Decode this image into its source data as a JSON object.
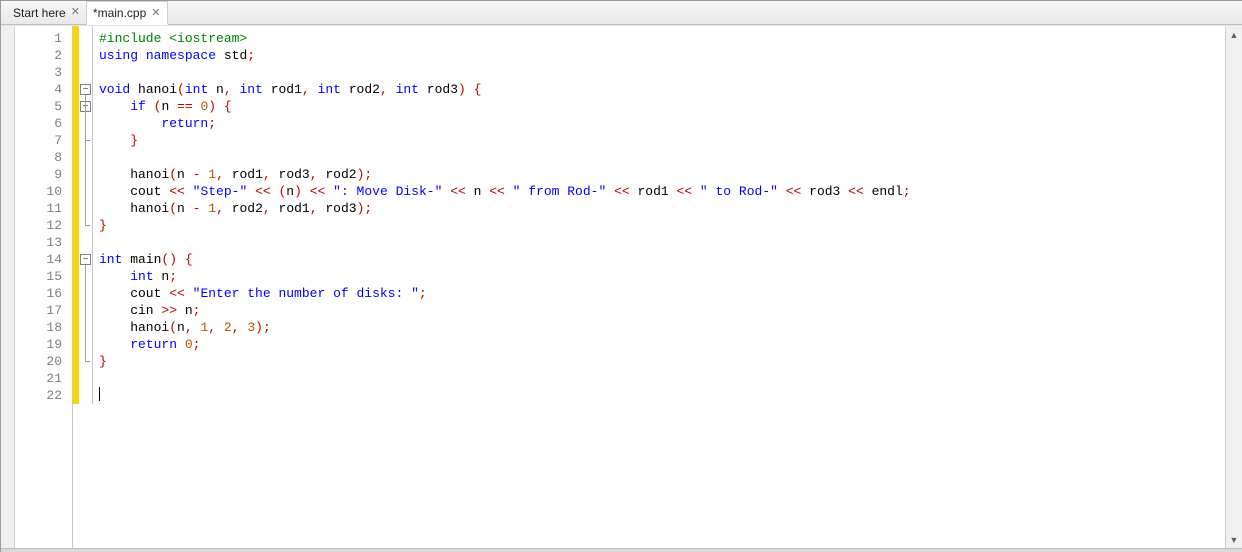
{
  "tabs": [
    {
      "label": "Start here",
      "active": false
    },
    {
      "label": "*main.cpp",
      "active": true
    }
  ],
  "line_count": 22,
  "fold_minus_lines": [
    4,
    5,
    14
  ],
  "code_lines": [
    [
      [
        "pp",
        "#include "
      ],
      [
        "inc",
        "<iostream>"
      ]
    ],
    [
      [
        "kw",
        "using"
      ],
      [
        "nm",
        " "
      ],
      [
        "kw",
        "namespace"
      ],
      [
        "nm",
        " std"
      ],
      [
        "op",
        ";"
      ]
    ],
    [],
    [
      [
        "kw",
        "void"
      ],
      [
        "nm",
        " hanoi"
      ],
      [
        "op",
        "("
      ],
      [
        "kw",
        "int"
      ],
      [
        "nm",
        " n"
      ],
      [
        "op",
        ","
      ],
      [
        "nm",
        " "
      ],
      [
        "kw",
        "int"
      ],
      [
        "nm",
        " rod1"
      ],
      [
        "op",
        ","
      ],
      [
        "nm",
        " "
      ],
      [
        "kw",
        "int"
      ],
      [
        "nm",
        " rod2"
      ],
      [
        "op",
        ","
      ],
      [
        "nm",
        " "
      ],
      [
        "kw",
        "int"
      ],
      [
        "nm",
        " rod3"
      ],
      [
        "op",
        ")"
      ],
      [
        "nm",
        " "
      ],
      [
        "brace",
        "{"
      ]
    ],
    [
      [
        "nm",
        "    "
      ],
      [
        "kw",
        "if"
      ],
      [
        "nm",
        " "
      ],
      [
        "op",
        "("
      ],
      [
        "nm",
        "n "
      ],
      [
        "op",
        "=="
      ],
      [
        "nm",
        " "
      ],
      [
        "num",
        "0"
      ],
      [
        "op",
        ")"
      ],
      [
        "nm",
        " "
      ],
      [
        "brace",
        "{"
      ]
    ],
    [
      [
        "nm",
        "        "
      ],
      [
        "kw",
        "return"
      ],
      [
        "op",
        ";"
      ]
    ],
    [
      [
        "nm",
        "    "
      ],
      [
        "brace",
        "}"
      ]
    ],
    [],
    [
      [
        "nm",
        "    hanoi"
      ],
      [
        "op",
        "("
      ],
      [
        "nm",
        "n "
      ],
      [
        "op",
        "-"
      ],
      [
        "nm",
        " "
      ],
      [
        "num",
        "1"
      ],
      [
        "op",
        ","
      ],
      [
        "nm",
        " rod1"
      ],
      [
        "op",
        ","
      ],
      [
        "nm",
        " rod3"
      ],
      [
        "op",
        ","
      ],
      [
        "nm",
        " rod2"
      ],
      [
        "op",
        ");"
      ]
    ],
    [
      [
        "nm",
        "    cout "
      ],
      [
        "op",
        "<<"
      ],
      [
        "nm",
        " "
      ],
      [
        "str",
        "\"Step-\""
      ],
      [
        "nm",
        " "
      ],
      [
        "op",
        "<<"
      ],
      [
        "nm",
        " "
      ],
      [
        "op",
        "("
      ],
      [
        "nm",
        "n"
      ],
      [
        "op",
        ")"
      ],
      [
        "nm",
        " "
      ],
      [
        "op",
        "<<"
      ],
      [
        "nm",
        " "
      ],
      [
        "str",
        "\": Move Disk-\""
      ],
      [
        "nm",
        " "
      ],
      [
        "op",
        "<<"
      ],
      [
        "nm",
        " n "
      ],
      [
        "op",
        "<<"
      ],
      [
        "nm",
        " "
      ],
      [
        "str",
        "\" from Rod-\""
      ],
      [
        "nm",
        " "
      ],
      [
        "op",
        "<<"
      ],
      [
        "nm",
        " rod1 "
      ],
      [
        "op",
        "<<"
      ],
      [
        "nm",
        " "
      ],
      [
        "str",
        "\" to Rod-\""
      ],
      [
        "nm",
        " "
      ],
      [
        "op",
        "<<"
      ],
      [
        "nm",
        " rod3 "
      ],
      [
        "op",
        "<<"
      ],
      [
        "nm",
        " endl"
      ],
      [
        "op",
        ";"
      ]
    ],
    [
      [
        "nm",
        "    hanoi"
      ],
      [
        "op",
        "("
      ],
      [
        "nm",
        "n "
      ],
      [
        "op",
        "-"
      ],
      [
        "nm",
        " "
      ],
      [
        "num",
        "1"
      ],
      [
        "op",
        ","
      ],
      [
        "nm",
        " rod2"
      ],
      [
        "op",
        ","
      ],
      [
        "nm",
        " rod1"
      ],
      [
        "op",
        ","
      ],
      [
        "nm",
        " rod3"
      ],
      [
        "op",
        ");"
      ]
    ],
    [
      [
        "brace",
        "}"
      ]
    ],
    [],
    [
      [
        "kw",
        "int"
      ],
      [
        "nm",
        " main"
      ],
      [
        "op",
        "()"
      ],
      [
        "nm",
        " "
      ],
      [
        "brace",
        "{"
      ]
    ],
    [
      [
        "nm",
        "    "
      ],
      [
        "kw",
        "int"
      ],
      [
        "nm",
        " n"
      ],
      [
        "op",
        ";"
      ]
    ],
    [
      [
        "nm",
        "    cout "
      ],
      [
        "op",
        "<<"
      ],
      [
        "nm",
        " "
      ],
      [
        "str",
        "\"Enter the number of disks: \""
      ],
      [
        "op",
        ";"
      ]
    ],
    [
      [
        "nm",
        "    cin "
      ],
      [
        "op",
        ">>"
      ],
      [
        "nm",
        " n"
      ],
      [
        "op",
        ";"
      ]
    ],
    [
      [
        "nm",
        "    hanoi"
      ],
      [
        "op",
        "("
      ],
      [
        "nm",
        "n"
      ],
      [
        "op",
        ","
      ],
      [
        "nm",
        " "
      ],
      [
        "num",
        "1"
      ],
      [
        "op",
        ","
      ],
      [
        "nm",
        " "
      ],
      [
        "num",
        "2"
      ],
      [
        "op",
        ","
      ],
      [
        "nm",
        " "
      ],
      [
        "num",
        "3"
      ],
      [
        "op",
        ");"
      ]
    ],
    [
      [
        "nm",
        "    "
      ],
      [
        "kw",
        "return"
      ],
      [
        "nm",
        " "
      ],
      [
        "num",
        "0"
      ],
      [
        "op",
        ";"
      ]
    ],
    [
      [
        "brace",
        "}"
      ]
    ],
    [],
    [
      [
        "cursor",
        ""
      ]
    ]
  ]
}
